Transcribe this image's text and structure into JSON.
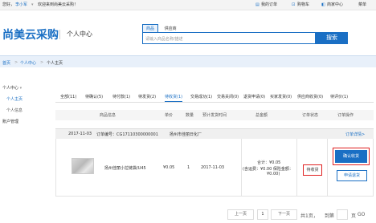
{
  "topbar": {
    "hello": "您好，",
    "user": "李小军",
    "welcome": "欢迎来到尚美云采购！",
    "my_orders": "我的订单",
    "cart": "购物车",
    "merchant_center": "商家中心",
    "menu": "菜单"
  },
  "header": {
    "logo": "尚美云采购",
    "page_title": "个人中心",
    "search_tab_goods": "商品",
    "search_tab_supplier": "供应商",
    "search_placeholder": "请输入商品名称/描述",
    "search_button": "搜索"
  },
  "breadcrumb": {
    "home": "首页",
    "sep1": ">",
    "level1": "个人中心",
    "sep2": ">",
    "level2": "个人主页"
  },
  "sidebar": {
    "group_title": "个人中心",
    "items": [
      {
        "label": "个人主页",
        "active": true
      },
      {
        "label": "个人信息",
        "active": false
      },
      {
        "label": "账户管理",
        "active": false
      }
    ]
  },
  "order_tabs": [
    "全部(11)",
    "待确认(5)",
    "待付款(1)",
    "待发货(2)",
    "待收货(1)",
    "交易成功(1)",
    "交易关闭(0)",
    "退货申请(0)",
    "买家发货(0)",
    "供应商收货(0)",
    "待评价(1)"
  ],
  "order_tabs_active": 4,
  "table_headers": {
    "product": "商品信息",
    "unit_price": "单价",
    "quantity": "数量",
    "ship_time": "预计发货时间",
    "total": "总金额",
    "status": "订单状态",
    "actions": "订单操作"
  },
  "order": {
    "date": "2017-11-03",
    "order_no": "订单编号：CG17110300000001",
    "vendor": "扬州市佳丽日化厂",
    "details_link": "订单详情>",
    "product_name": "扬州佳丽小拉链袋/U45",
    "unit_price": "¥0.05",
    "quantity": "1",
    "ship_date": "2017-11-03",
    "total_line": "合计：¥0.05",
    "total_detail": "(含运费：¥0.00 保险金额：",
    "total_detail2": "¥0.00)",
    "status": "待收货",
    "confirm_btn": "确认收货",
    "refund_btn": "申请退货"
  },
  "pagination": {
    "prev": "上一页",
    "current": "1",
    "next": "下一页",
    "total_pages": "共1页，",
    "goto": "到第",
    "page_unit": "页",
    "go": "GO"
  },
  "colors": {
    "accent": "#1a6fc4",
    "highlight_border": "#e02020"
  }
}
